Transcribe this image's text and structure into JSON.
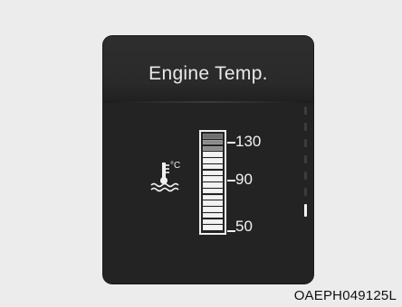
{
  "panel": {
    "title": "Engine Temp.",
    "gauge": {
      "scale_labels": [
        "130",
        "90",
        "50"
      ],
      "unit": "°C",
      "segments_total": 16,
      "segments_lit": 13
    },
    "icon": "engine-coolant-temperature-icon"
  },
  "caption": "OAEPH049125L"
}
